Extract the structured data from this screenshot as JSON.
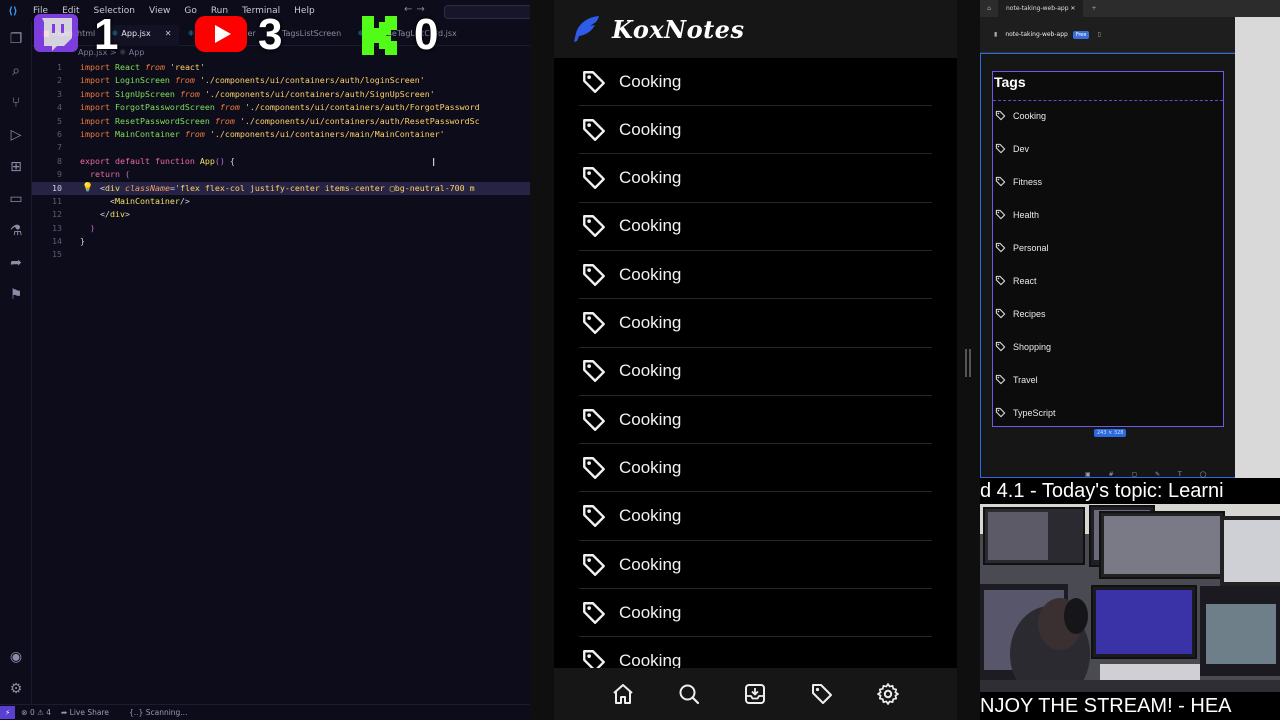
{
  "vscode": {
    "menu": [
      "File",
      "Edit",
      "Selection",
      "View",
      "Go",
      "Run",
      "Terminal",
      "Help"
    ],
    "tabs": [
      {
        "label": "index.html",
        "icon": "html-icon"
      },
      {
        "label": "App.jsx",
        "icon": "react-icon"
      },
      {
        "label": "MainContainer",
        "icon": "react-icon"
      },
      {
        "label": "TagsListScreen",
        "icon": "react-icon"
      },
      {
        "label": "ChooseTagListCard.jsx",
        "icon": "react-icon"
      }
    ],
    "active_tab_close": "✕",
    "breadcrumb": "App.jsx > ⚛ App",
    "code_lines": [
      {
        "n": "1",
        "text": "import React from 'react'"
      },
      {
        "n": "2",
        "text": "import LoginScreen from './components/ui/containers/auth/loginScreen'"
      },
      {
        "n": "3",
        "text": "import SignUpScreen from './components/ui/containers/auth/SignUpScreen'"
      },
      {
        "n": "4",
        "text": "import ForgotPasswordScreen from './components/ui/containers/auth/ForgotPassword"
      },
      {
        "n": "5",
        "text": "import ResetPasswordScreen from './components/ui/containers/auth/ResetPasswordSc"
      },
      {
        "n": "6",
        "text": "import MainContainer from './components/ui/containers/main/MainContainer'"
      },
      {
        "n": "7",
        "text": ""
      },
      {
        "n": "8",
        "text": "export default function App() {"
      },
      {
        "n": "9",
        "text": "  return ("
      },
      {
        "n": "10",
        "text": "    <div className='flex flex-col justify-center items-center ▢bg-neutral-700 m"
      },
      {
        "n": "11",
        "text": "      <MainContainer/>"
      },
      {
        "n": "12",
        "text": "    </div>"
      },
      {
        "n": "13",
        "text": "  )"
      },
      {
        "n": "14",
        "text": "}"
      },
      {
        "n": "15",
        "text": ""
      }
    ],
    "status": {
      "problems": "⊗ 0 ⚠ 4",
      "live_share": "Live Share",
      "scanning": "{..} Scanning..."
    }
  },
  "overlay": {
    "twitch_count": "1",
    "youtube_count": "3",
    "kick_count": "0",
    "colors": {
      "twitch": "#9146ff",
      "youtube": "#ff0000",
      "kick": "#53fc18"
    }
  },
  "koxnotes": {
    "app_name": "KoxNotes",
    "accent": "#2f5bea",
    "tags": [
      "Cooking",
      "Cooking",
      "Cooking",
      "Cooking",
      "Cooking",
      "Cooking",
      "Cooking",
      "Cooking",
      "Cooking",
      "Cooking",
      "Cooking",
      "Cooking",
      "Cooking"
    ],
    "nav": [
      "home-icon",
      "search-icon",
      "archive-icon",
      "tag-icon",
      "settings-icon"
    ]
  },
  "figma": {
    "browser_tab": "note-taking-web-app",
    "file_name": "note-taking-web-app",
    "plan_badge": "Free",
    "frame_title": "Tags",
    "tags": [
      "Cooking",
      "Dev",
      "Fitness",
      "Health",
      "Personal",
      "React",
      "Recipes",
      "Shopping",
      "Travel",
      "TypeScript"
    ],
    "size_label": "243 × 328"
  },
  "stream": {
    "ticker_top": "d 4.1  -  Today's topic: Learni",
    "ticker_bottom": "NJOY THE STREAM!  - HEA"
  }
}
